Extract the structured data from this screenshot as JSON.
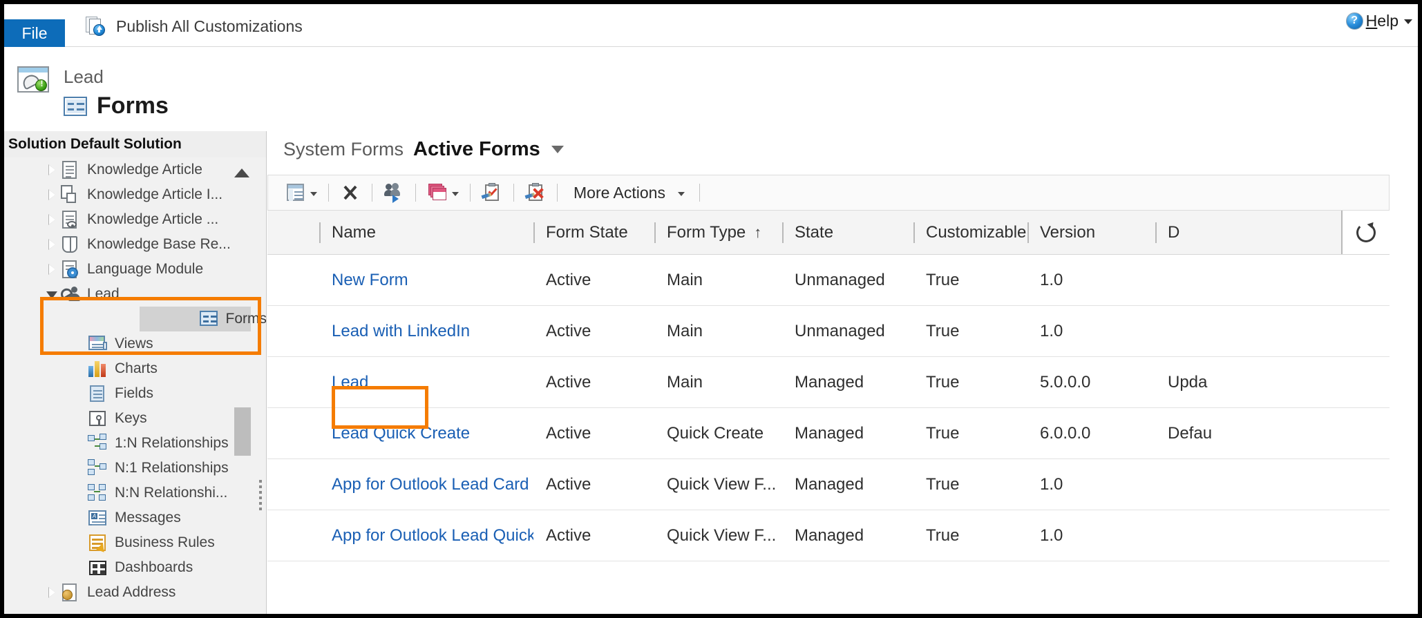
{
  "ribbon": {
    "file_tab": "File",
    "publish_label": "Publish All Customizations",
    "publish_icon": "publish-customizations-icon",
    "help_label_prefix": "H",
    "help_label_rest": "elp",
    "help_icon": "question-mark-icon",
    "help_caret": "chevron-down-icon"
  },
  "titlebar": {
    "entity_name": "Lead",
    "page_title": "Forms",
    "entity_icon": "lead-entity-icon",
    "forms_icon": "forms-icon"
  },
  "sidebar": {
    "solution_label": "Solution",
    "solution_name": "Default Solution",
    "tree": [
      {
        "label": "Knowledge Article",
        "level": 1,
        "expander": "closed",
        "icon": "document-icon",
        "selected": false
      },
      {
        "label": "Knowledge Article I...",
        "level": 1,
        "expander": "closed",
        "icon": "article-incident-icon",
        "selected": false
      },
      {
        "label": "Knowledge Article ...",
        "level": 1,
        "expander": "closed",
        "icon": "article-view-icon",
        "selected": false
      },
      {
        "label": "Knowledge Base Re...",
        "level": 1,
        "expander": "closed",
        "icon": "book-icon",
        "selected": false
      },
      {
        "label": "Language Module",
        "level": 1,
        "expander": "closed",
        "icon": "language-module-icon",
        "selected": false
      },
      {
        "label": "Lead",
        "level": 1,
        "expander": "open",
        "icon": "lead-icon",
        "selected": false
      },
      {
        "label": "Forms",
        "level": 2,
        "expander": "none",
        "icon": "forms-icon",
        "selected": true
      },
      {
        "label": "Views",
        "level": 2,
        "expander": "none",
        "icon": "views-icon",
        "selected": false
      },
      {
        "label": "Charts",
        "level": 2,
        "expander": "none",
        "icon": "charts-icon",
        "selected": false
      },
      {
        "label": "Fields",
        "level": 2,
        "expander": "none",
        "icon": "fields-icon",
        "selected": false
      },
      {
        "label": "Keys",
        "level": 2,
        "expander": "none",
        "icon": "keys-icon",
        "selected": false
      },
      {
        "label": "1:N Relationships",
        "level": 2,
        "expander": "none",
        "icon": "one-to-many-icon",
        "selected": false
      },
      {
        "label": "N:1 Relationships",
        "level": 2,
        "expander": "none",
        "icon": "many-to-one-icon",
        "selected": false
      },
      {
        "label": "N:N Relationshi...",
        "level": 2,
        "expander": "none",
        "icon": "many-to-many-icon",
        "selected": false
      },
      {
        "label": "Messages",
        "level": 2,
        "expander": "none",
        "icon": "messages-icon",
        "selected": false
      },
      {
        "label": "Business Rules",
        "level": 2,
        "expander": "none",
        "icon": "business-rules-icon",
        "selected": false
      },
      {
        "label": "Dashboards",
        "level": 2,
        "expander": "none",
        "icon": "dashboards-icon",
        "selected": false
      },
      {
        "label": "Lead Address",
        "level": 1,
        "expander": "closed",
        "icon": "lead-address-icon",
        "selected": false
      }
    ],
    "scroll_up_icon": "scroll-up-arrow-icon",
    "splitter": "sidebar-splitter-handle"
  },
  "main": {
    "view_selector": {
      "prefix": "System Forms",
      "current": "Active Forms",
      "caret": "chevron-down-icon"
    },
    "toolbar": {
      "new_label": "",
      "new_icon": "new-form-icon",
      "delete_icon": "delete-x-icon",
      "assign_icon": "assign-security-roles-icon",
      "form_order_icon": "form-order-icon",
      "activate_icon": "activate-clipboard-icon",
      "deactivate_icon": "deactivate-clipboard-icon",
      "more_actions_label": "More Actions",
      "more_actions_caret": "chevron-down-icon"
    },
    "grid": {
      "columns": [
        {
          "label": "Name",
          "sort": ""
        },
        {
          "label": "Form State",
          "sort": ""
        },
        {
          "label": "Form Type",
          "sort": "↑"
        },
        {
          "label": "State",
          "sort": ""
        },
        {
          "label": "Customizable",
          "sort": ""
        },
        {
          "label": "Version",
          "sort": ""
        },
        {
          "label": "D",
          "sort": ""
        }
      ],
      "refresh_icon": "refresh-spinner-icon",
      "rows": [
        {
          "name": "New Form",
          "form_state": "Active",
          "form_type": "Main",
          "state": "Unmanaged",
          "customizable": "True",
          "version": "1.0",
          "description": "",
          "highlighted": false
        },
        {
          "name": "Lead with LinkedIn",
          "form_state": "Active",
          "form_type": "Main",
          "state": "Unmanaged",
          "customizable": "True",
          "version": "1.0",
          "description": "",
          "highlighted": false
        },
        {
          "name": "Lead",
          "form_state": "Active",
          "form_type": "Main",
          "state": "Managed",
          "customizable": "True",
          "version": "5.0.0.0",
          "description": "Upda",
          "highlighted": true
        },
        {
          "name": "Lead Quick Create",
          "form_state": "Active",
          "form_type": "Quick Create",
          "state": "Managed",
          "customizable": "True",
          "version": "6.0.0.0",
          "description": "Defau",
          "highlighted": false
        },
        {
          "name": "App for Outlook Lead Card",
          "form_state": "Active",
          "form_type": "Quick View F...",
          "state": "Managed",
          "customizable": "True",
          "version": "1.0",
          "description": "",
          "highlighted": false
        },
        {
          "name": "App for Outlook Lead Quick Vi...",
          "form_state": "Active",
          "form_type": "Quick View F...",
          "state": "Managed",
          "customizable": "True",
          "version": "1.0",
          "description": "",
          "highlighted": false
        }
      ]
    }
  },
  "annotations": {
    "accent_color": "#f57c00",
    "tree_box": "highlight-box-forms-tree-node",
    "row_box": "highlight-box-lead-form-row"
  }
}
